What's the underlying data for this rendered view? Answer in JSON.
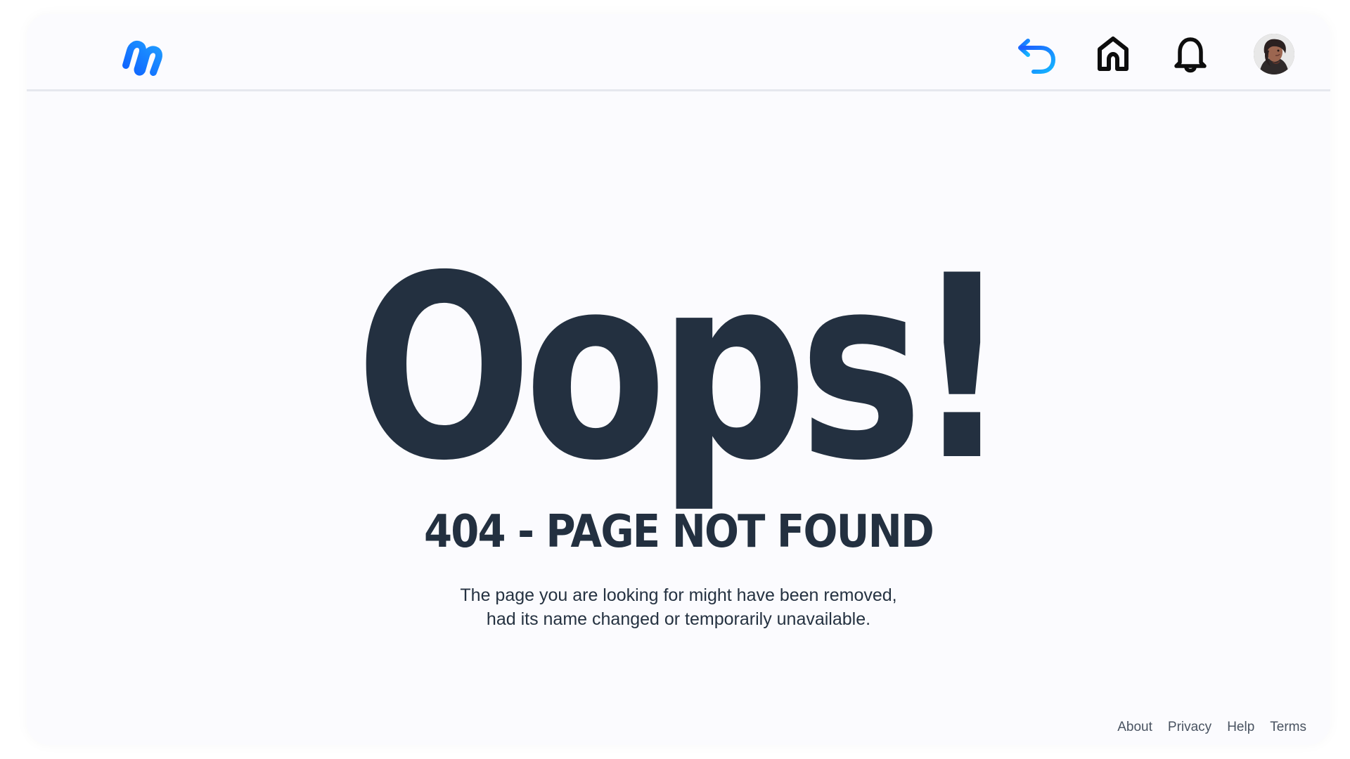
{
  "header": {
    "logo_icon": "brand-logo-icon",
    "actions": [
      {
        "name": "back-icon",
        "label": "Back"
      },
      {
        "name": "home-icon",
        "label": "Home"
      },
      {
        "name": "bell-icon",
        "label": "Notifications"
      }
    ],
    "avatar_icon": "user-avatar"
  },
  "error": {
    "headline": "Oops!",
    "code_text": "404 - PAGE NOT FOUND",
    "description_line_1": "The page you are looking for might have been removed,",
    "description_line_2": "had its name changed or temporarily unavailable."
  },
  "footer": {
    "links": [
      {
        "label": "About"
      },
      {
        "label": "Privacy"
      },
      {
        "label": "Help"
      },
      {
        "label": "Terms"
      }
    ]
  },
  "colors": {
    "dark_text": "#233040",
    "accent_blue": "#168cff",
    "logo_blue": "#1557ff",
    "background": "#fbfbfe"
  }
}
